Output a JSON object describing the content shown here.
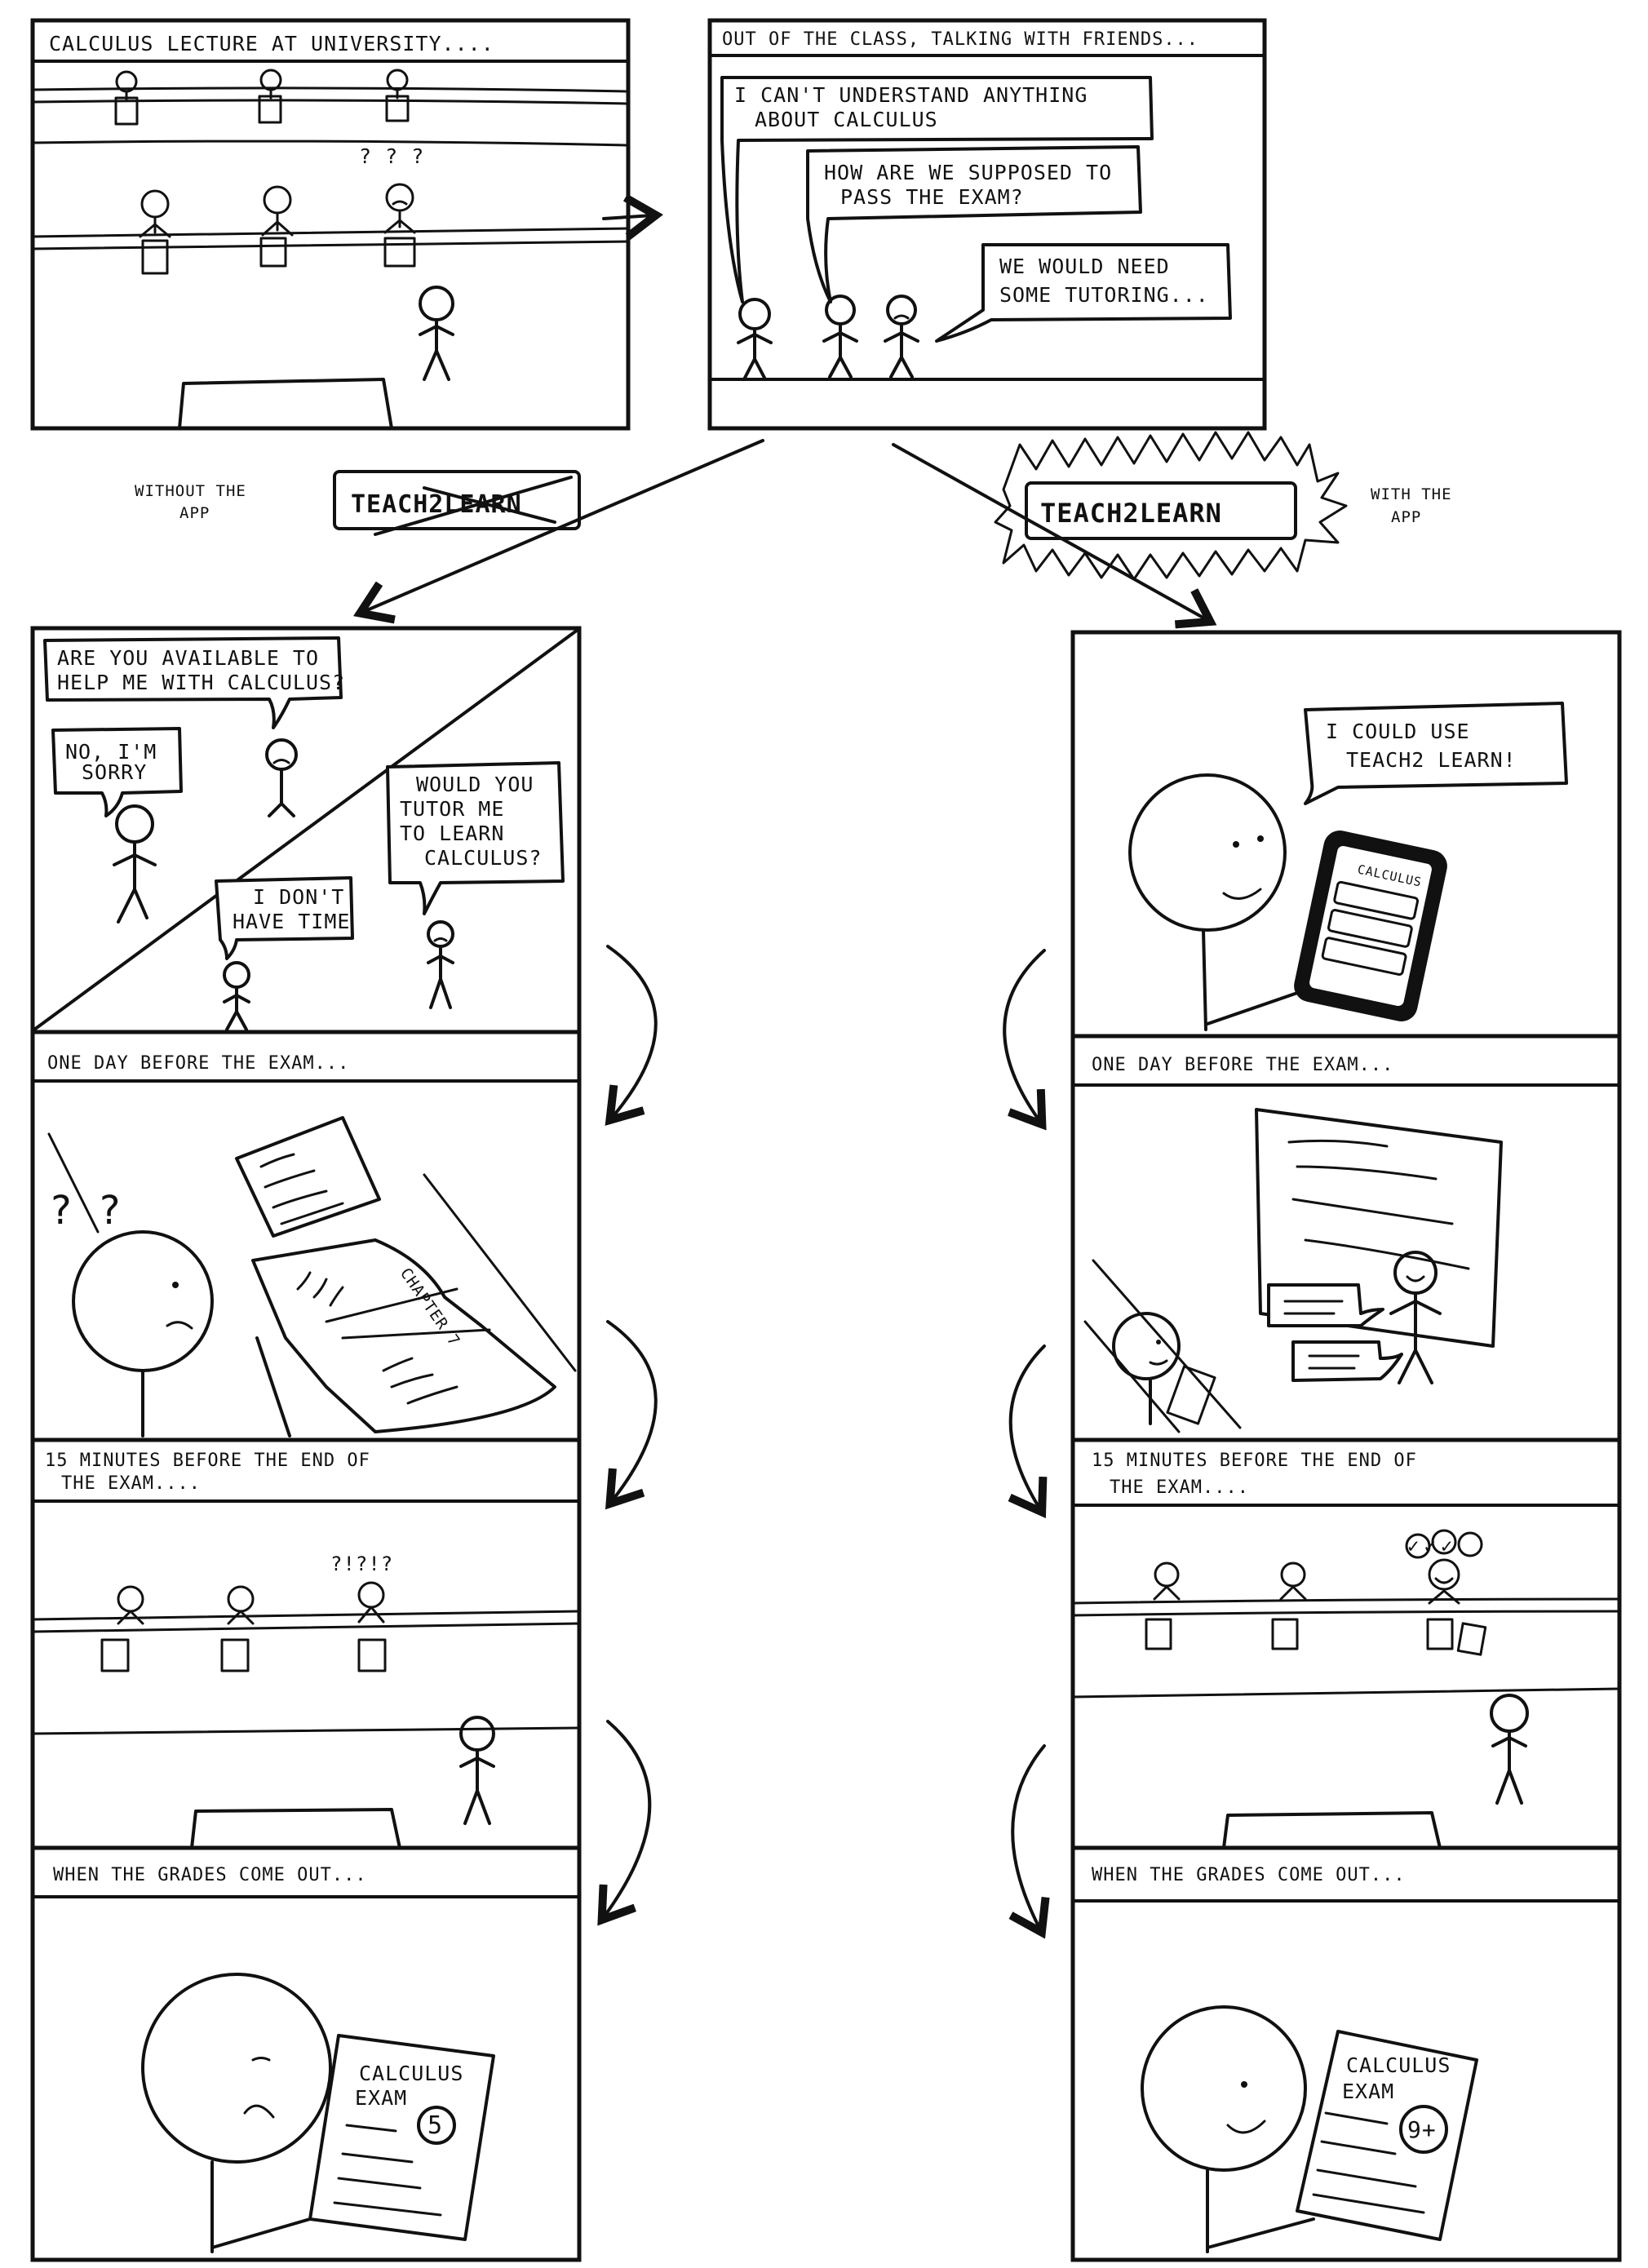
{
  "top": {
    "panel1_caption": "Calculus lecture at university....",
    "panel1_question": "? ? ?",
    "panel2_caption": "Out of the class, talking with friends...",
    "bubble1": [
      "I can't understand anything",
      "about calculus"
    ],
    "bubble2": [
      "How are we supposed to",
      "pass the exam?"
    ],
    "bubble3": [
      "We would need",
      "some tutoring..."
    ]
  },
  "branch": {
    "left_note": [
      "Without the",
      "app"
    ],
    "left_logo": "TEACH2LEARN",
    "right_note": [
      "With the",
      "app"
    ],
    "right_logo": "TEACH2LEARN"
  },
  "left": {
    "bubble_a": [
      "Are you available to",
      "help me with calculus?"
    ],
    "bubble_b": [
      "No, I'm",
      "sorry"
    ],
    "bubble_c": [
      "Would you",
      "tutor me",
      "to learn",
      "calculus?"
    ],
    "bubble_d": [
      "I don't",
      "have time"
    ],
    "cap2": "One day before the exam...",
    "question": "? ?",
    "book_label": "Chapter 7",
    "cap3": [
      "15 minutes before the end of",
      "the exam...."
    ],
    "exam_marks": "?!?!?",
    "cap4": "When the grades come out...",
    "paper_title": [
      "Calculus",
      "exam"
    ],
    "grade": "5"
  },
  "right": {
    "bubble": [
      "I could use",
      "Teach2 learn!"
    ],
    "phone_title": "Calculus",
    "cap2": "One day before the exam...",
    "cap3": [
      "15 minutes before the end of",
      "the exam...."
    ],
    "checks": "✓✓✓",
    "cap4": "When the grades come out...",
    "paper_title": [
      "Calculus",
      "exam"
    ],
    "grade": "9+"
  }
}
